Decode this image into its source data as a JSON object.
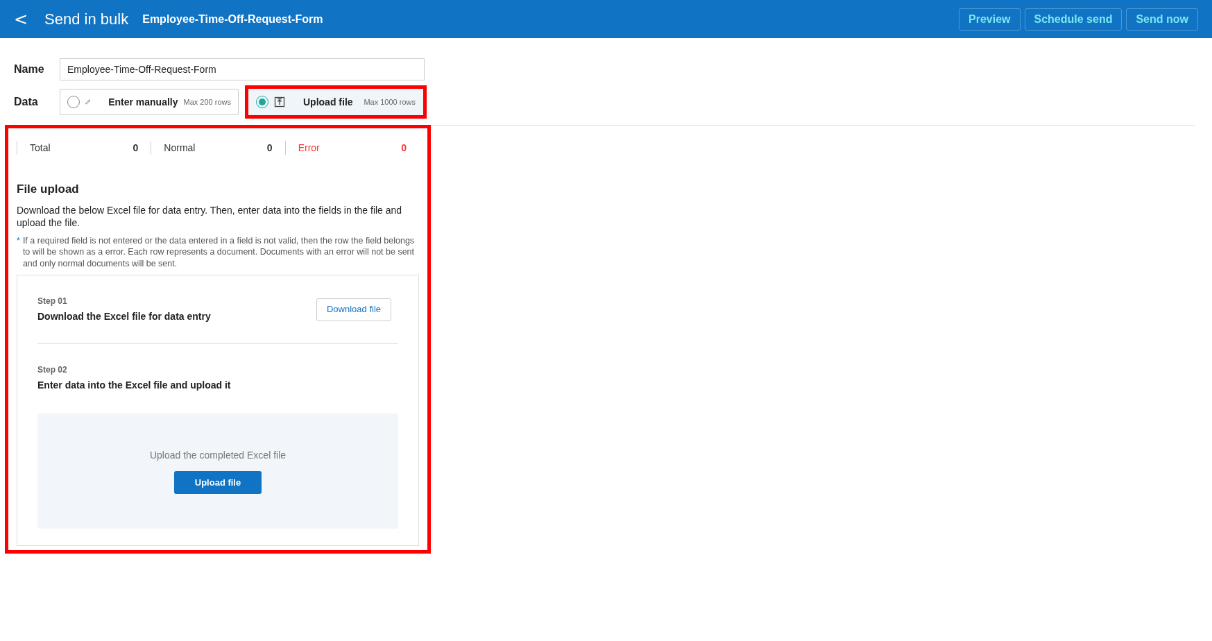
{
  "header": {
    "back_label": "<",
    "title": "Send in bulk",
    "subtitle": "Employee-Time-Off-Request-Form",
    "buttons": [
      "Preview",
      "Schedule send",
      "Send now"
    ]
  },
  "name_field": {
    "label": "Name",
    "value": "Employee-Time-Off-Request-Form"
  },
  "data_options": {
    "label": "Data",
    "items": [
      {
        "kind": "manual",
        "label": "Enter manually",
        "limit": "Max 200 rows",
        "selected": false,
        "highlighted": false
      },
      {
        "kind": "upload",
        "label": "Upload file",
        "limit": "Max 1000 rows",
        "selected": true,
        "highlighted": true
      }
    ]
  },
  "upload_panel": {
    "highlighted": true,
    "stats": [
      {
        "label": "Total",
        "count": "0",
        "kind": "normal"
      },
      {
        "label": "Normal",
        "count": "0",
        "kind": "normal"
      },
      {
        "label": "Error",
        "count": "0",
        "kind": "error"
      }
    ],
    "title": "File upload",
    "description": "Download the below Excel file for data entry. Then, enter data into the fields in the file and upload the file.",
    "note_mark": "*",
    "note": "If a required field is not entered or the data entered in a field is not valid, then the row the field belongs to will be shown as a error. Each row represents a document. Documents with an error will not be sent and only normal documents will be sent.",
    "steps": [
      {
        "kind": "download",
        "step": "Step 01",
        "title": "Download the Excel file for data entry",
        "button": "Download file"
      },
      {
        "kind": "upload",
        "step": "Step 02",
        "title": "Enter data into the Excel file and upload it",
        "hint": "Upload the completed Excel file",
        "button": "Upload file"
      }
    ]
  }
}
